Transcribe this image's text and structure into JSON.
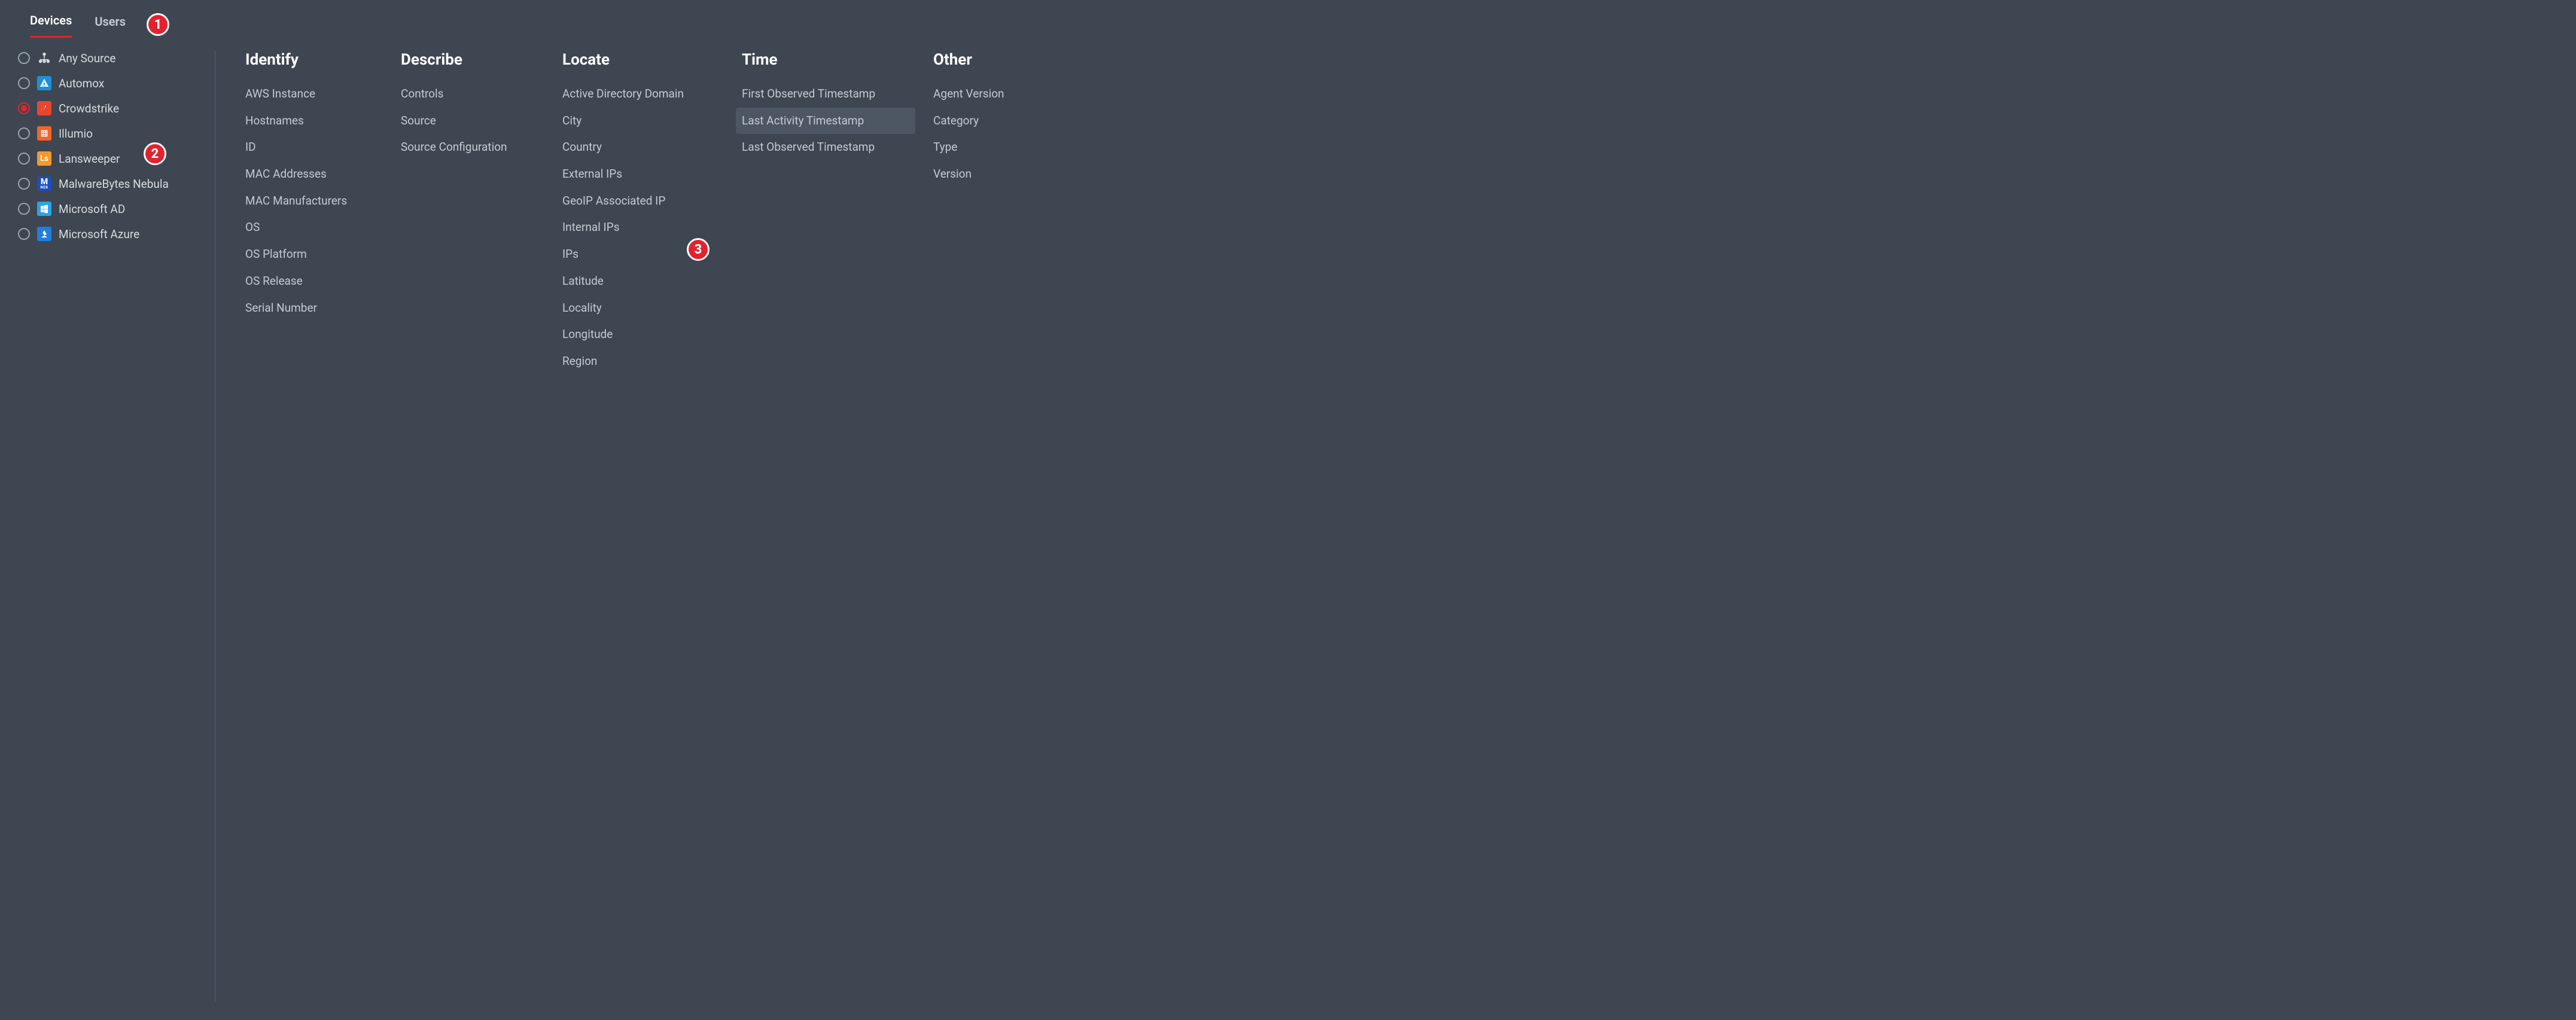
{
  "tabs": [
    {
      "label": "Devices",
      "active": true
    },
    {
      "label": "Users",
      "active": false
    }
  ],
  "sources": [
    {
      "label": "Any Source",
      "icon_name": "any-source-icon",
      "selected": false,
      "icon_bg": "transparent",
      "icon_fg": "#d5d9de",
      "glyph": "three-dots-tree"
    },
    {
      "label": "Automox",
      "icon_name": "automox-icon",
      "selected": false,
      "icon_bg": "#1f8fd6",
      "icon_fg": "#ffffff",
      "glyph": "triangle"
    },
    {
      "label": "Crowdstrike",
      "icon_name": "crowdstrike-icon",
      "selected": true,
      "icon_bg": "#e8472e",
      "icon_fg": "#ffffff",
      "glyph": "bird"
    },
    {
      "label": "Illumio",
      "icon_name": "illumio-icon",
      "selected": false,
      "icon_bg": "#f2652b",
      "icon_fg": "#ffffff",
      "glyph": "grid-arrows"
    },
    {
      "label": "Lansweeper",
      "icon_name": "lansweeper-icon",
      "selected": false,
      "icon_bg": "#f29a2e",
      "icon_fg": "#ffffff",
      "glyph": "Ls"
    },
    {
      "label": "MalwareBytes Nebula",
      "icon_name": "malwarebytes-icon",
      "selected": false,
      "icon_bg": "#1e4dbf",
      "icon_fg": "#ffffff",
      "glyph": "M"
    },
    {
      "label": "Microsoft AD",
      "icon_name": "microsoft-ad-icon",
      "selected": false,
      "icon_bg": "#2aa3e8",
      "icon_fg": "#ffffff",
      "glyph": "windows"
    },
    {
      "label": "Microsoft Azure",
      "icon_name": "microsoft-azure-icon",
      "selected": false,
      "icon_bg": "#1f7fe0",
      "icon_fg": "#ffffff",
      "glyph": "azure"
    }
  ],
  "columns": {
    "identify": {
      "heading": "Identify",
      "fields": [
        "AWS Instance",
        "Hostnames",
        "ID",
        "MAC Addresses",
        "MAC Manufacturers",
        "OS",
        "OS Platform",
        "OS Release",
        "Serial Number"
      ]
    },
    "describe": {
      "heading": "Describe",
      "fields": [
        "Controls",
        "Source",
        "Source Configuration"
      ]
    },
    "locate": {
      "heading": "Locate",
      "fields": [
        "Active Directory Domain",
        "City",
        "Country",
        "External IPs",
        "GeoIP Associated IP",
        "Internal IPs",
        "IPs",
        "Latitude",
        "Locality",
        "Longitude",
        "Region"
      ]
    },
    "time": {
      "heading": "Time",
      "fields": [
        "First Observed Timestamp",
        "Last Activity Timestamp",
        "Last Observed Timestamp"
      ],
      "selected_index": 1
    },
    "other": {
      "heading": "Other",
      "fields": [
        "Agent Version",
        "Category",
        "Type",
        "Version"
      ]
    }
  },
  "annotations": [
    {
      "n": "1"
    },
    {
      "n": "2"
    },
    {
      "n": "3"
    }
  ]
}
